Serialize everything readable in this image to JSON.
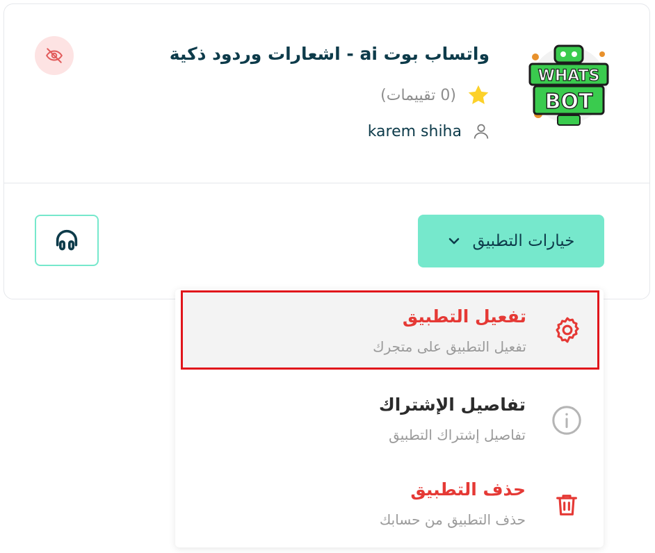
{
  "app": {
    "title": "واتساب بوت ai - اشعارات وردود ذكية",
    "rating_text": "(0 تقييمات)",
    "author": "karem shiha",
    "logo_text_line1": "WHATS",
    "logo_text_line2": "BOT"
  },
  "actions": {
    "options_label": "خيارات التطبيق"
  },
  "menu": {
    "items": [
      {
        "title": "تفعيل التطبيق",
        "description": "تفعيل التطبيق على متجرك",
        "icon": "gear-icon",
        "color": "#e53935"
      },
      {
        "title": "تفاصيل الإشتراك",
        "description": "تفاصيل إشتراك التطبيق",
        "icon": "info-icon",
        "color": "#2b2b2b"
      },
      {
        "title": "حذف التطبيق",
        "description": "حذف التطبيق من حسابك",
        "icon": "trash-icon",
        "color": "#e53935"
      }
    ]
  },
  "colors": {
    "accent": "#76e8cc",
    "danger": "#e53935",
    "title": "#0d3b4a",
    "highlight_border": "#e0151b"
  }
}
